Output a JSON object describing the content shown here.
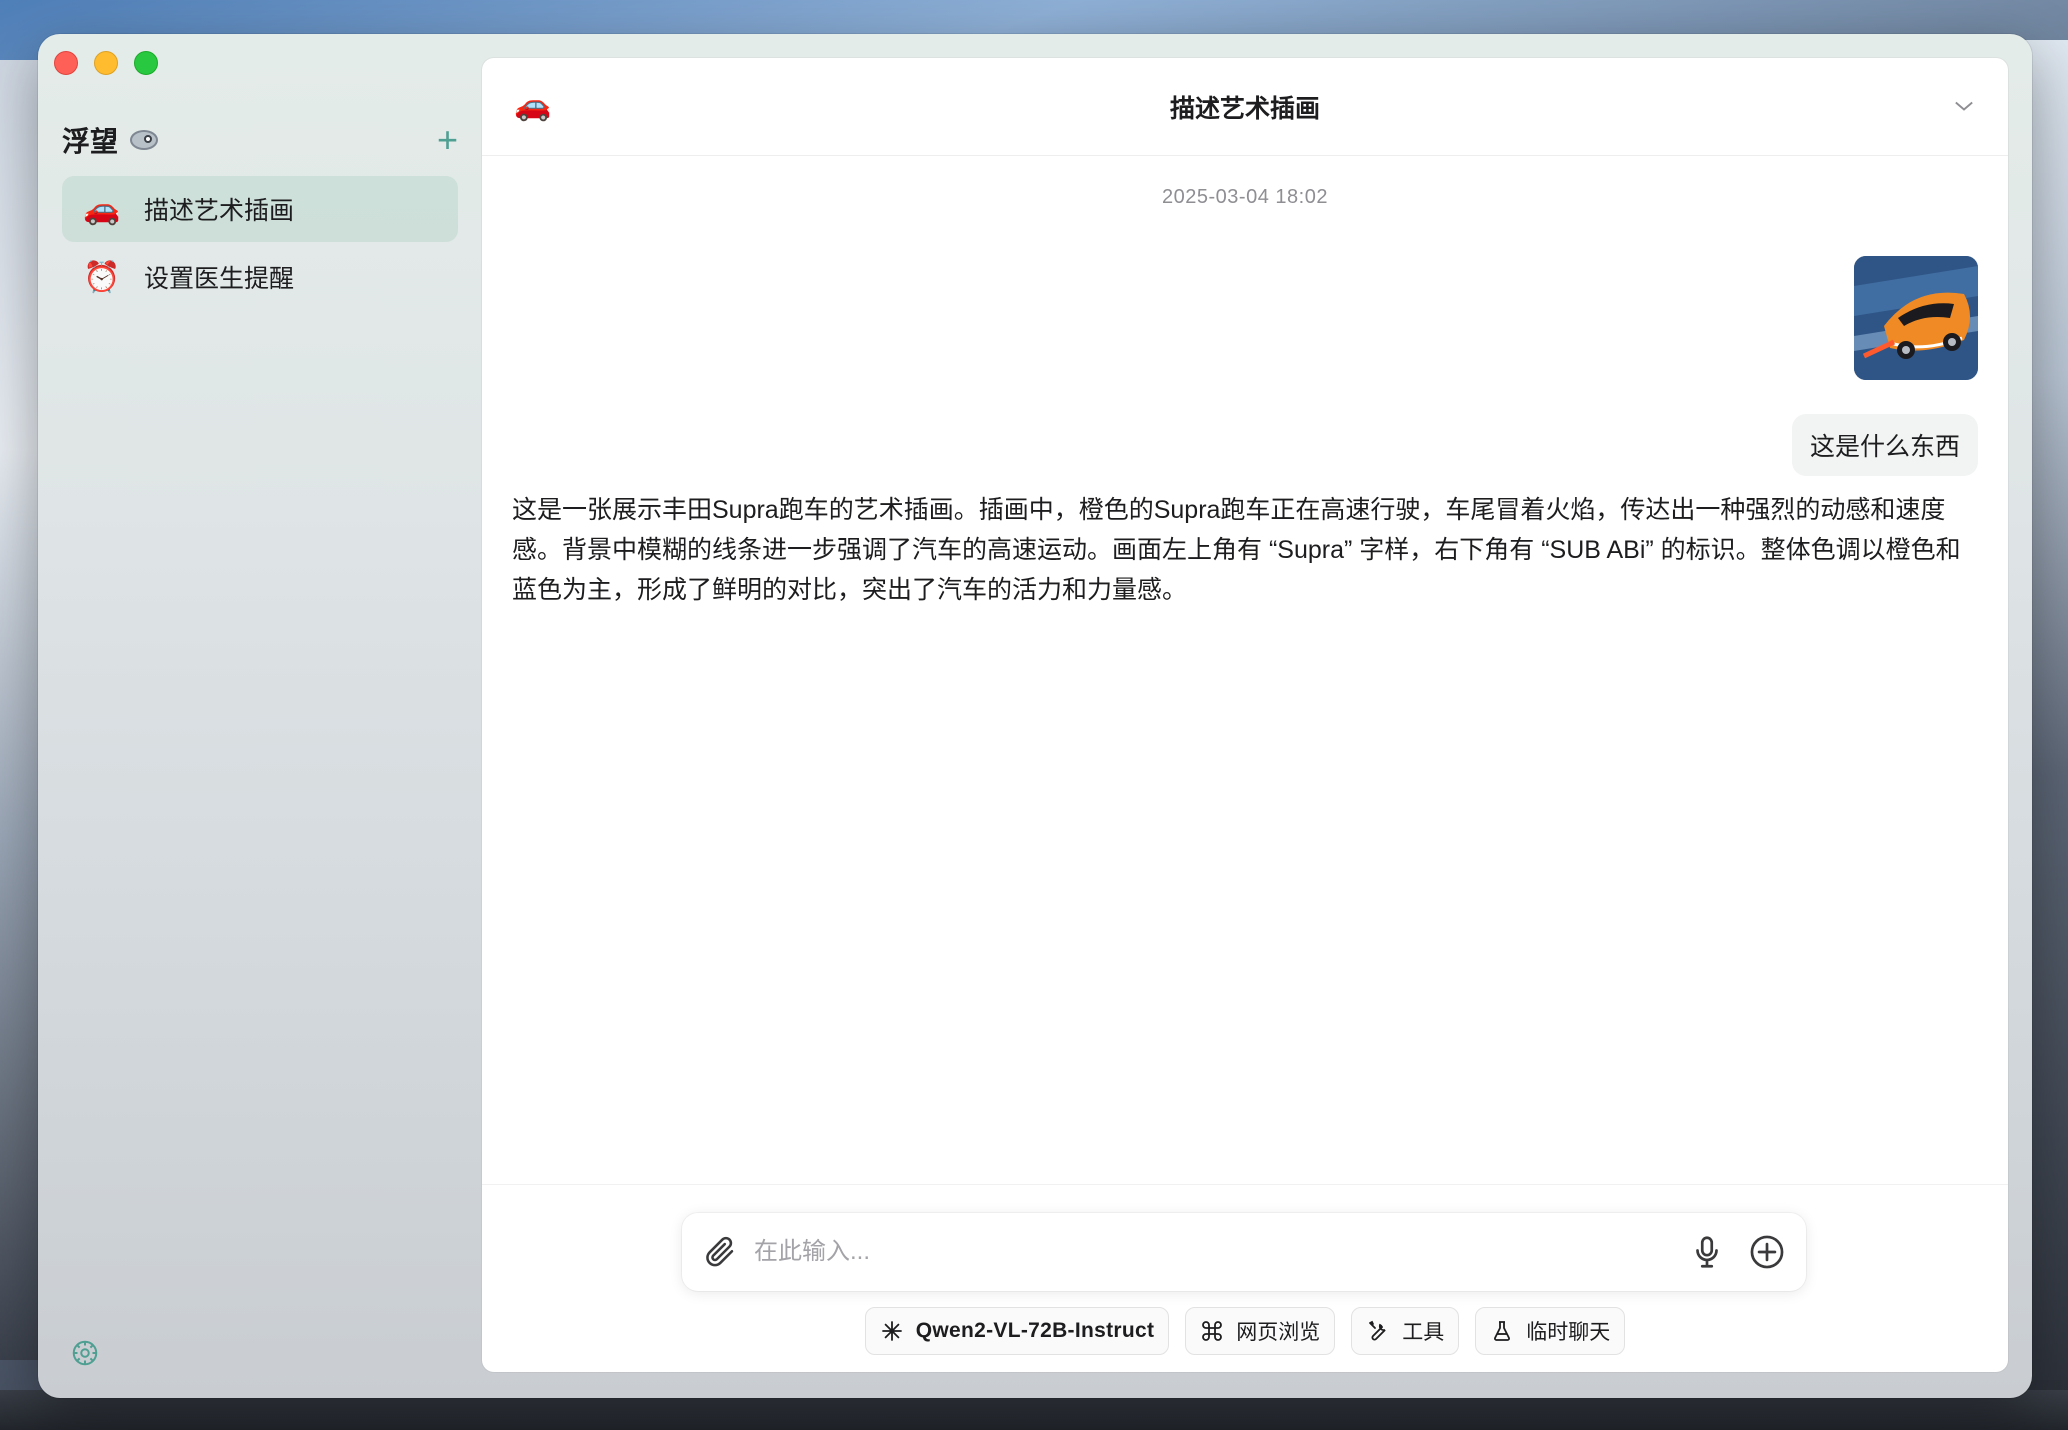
{
  "app": {
    "name": "浮望"
  },
  "sidebar": {
    "title": "浮望",
    "add_label": "+",
    "items": [
      {
        "emoji": "🚗",
        "label": "描述艺术插画",
        "active": true
      },
      {
        "emoji": "⏰",
        "label": "设置医生提醒",
        "active": false
      }
    ],
    "icons": {
      "title_icon": "eye-creature-icon",
      "settings": "gear-icon"
    }
  },
  "chat": {
    "header_emoji": "🚗",
    "title": "描述艺术插画",
    "timestamp": "2025-03-04 18:02",
    "user_message": "这是什么东西",
    "assistant_message": "这是一张展示丰田Supra跑车的艺术插画。插画中，橙色的Supra跑车正在高速行驶，车尾冒着火焰，传达出一种强烈的动感和速度感。背景中模糊的线条进一步强调了汽车的高速运动。画面左上角有 “Supra” 字样，右下角有 “SUB ABi” 的标识。整体色调以橙色和蓝色为主，形成了鲜明的对比，突出了汽车的活力和力量感。"
  },
  "composer": {
    "placeholder": "在此输入..."
  },
  "chips": {
    "model": "Qwen2-VL-72B-Instruct",
    "web": "网页浏览",
    "tools": "工具",
    "temp_chat": "临时聊天"
  },
  "colors": {
    "accent": "#4f9f92",
    "traffic_red": "#fe5f57",
    "traffic_yellow": "#febc2e",
    "traffic_green": "#28c840"
  }
}
